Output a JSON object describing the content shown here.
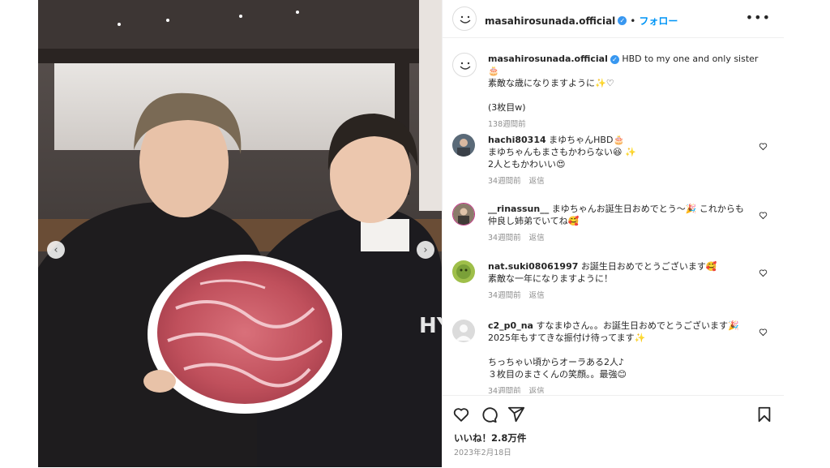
{
  "header": {
    "username": "masahirosunada.official",
    "dot": "•",
    "follow_label": "フォロー",
    "more_label": "•••"
  },
  "caption": {
    "username": "masahirosunada.official",
    "line1": "HBD to my one and only sister🎂",
    "line2": "素敵な歳になりますように✨♡",
    "line3": "(3枚目w)",
    "time": "138週間前"
  },
  "comments": [
    {
      "username": "hachi80314",
      "lines": [
        "まゆちゃんHBD🎂",
        "まゆちゃんもまさもかわらない😆 ✨",
        "2人ともかわいい😍"
      ],
      "time": "34週間前",
      "reply": "返信"
    },
    {
      "username": "__rinassun__",
      "lines": [
        "まゆちゃんお誕生日おめでとう〜🎉 これからも",
        "仲良し姉弟でいてね🥰"
      ],
      "time": "34週間前",
      "reply": "返信"
    },
    {
      "username": "nat.suki08061997",
      "lines": [
        "お誕生日おめでとうございます🥰",
        "素敵な一年になりますように！"
      ],
      "time": "34週間前",
      "reply": "返信"
    },
    {
      "username": "c2_p0_na",
      "lines": [
        "すなまゆさん。。お誕生日おめでとうございます🎉",
        "2025年もすてきな振付け待ってます✨",
        "",
        "ちっちゃい頃からオーラある2人♪",
        "３枚目のまさくんの笑顔。。最強😊"
      ],
      "time": "34週間前",
      "reply": "返信"
    }
  ],
  "footer": {
    "likes": "いいね！2.8万件",
    "date": "2023年2月18日"
  },
  "icons": {
    "verified": "verified-badge-icon",
    "like": "heart-icon",
    "comment": "comment-icon",
    "share": "share-icon",
    "save": "bookmark-icon"
  },
  "colors": {
    "accent": "#0095f6",
    "verified": "#3897f0",
    "meta": "#8e8e8e"
  }
}
